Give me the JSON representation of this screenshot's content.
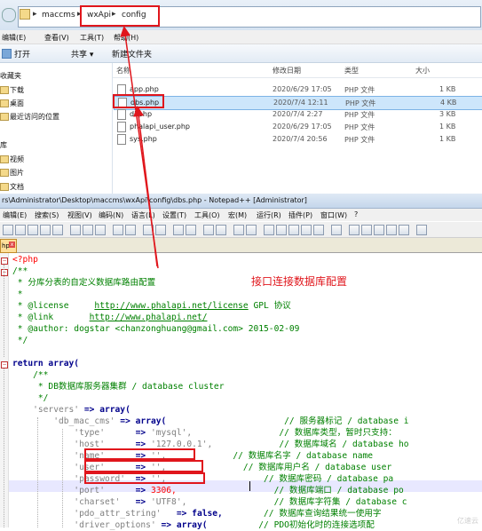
{
  "explorer": {
    "breadcrumb": [
      "maccms",
      "wxApi",
      "config"
    ],
    "menu": [
      "编辑(E)",
      "查看(V)",
      "工具(T)",
      "帮助(H)"
    ],
    "toolbar": {
      "open": "打开",
      "share": "共享 ▾",
      "new_folder": "新建文件夹"
    },
    "nav_items": [
      {
        "label": "收藏夹",
        "icon": "star-icon"
      },
      {
        "label": "下载",
        "icon": "folder-icon"
      },
      {
        "label": "桌面",
        "icon": "folder-icon"
      },
      {
        "label": "最近访问的位置",
        "icon": "folder-icon"
      },
      {
        "label": "库",
        "icon": "library-icon"
      },
      {
        "label": "视频",
        "icon": "folder-icon"
      },
      {
        "label": "图片",
        "icon": "folder-icon"
      },
      {
        "label": "文档",
        "icon": "folder-icon"
      }
    ],
    "columns": {
      "name": "名称",
      "modified": "修改日期",
      "type": "类型",
      "size": "大小"
    },
    "files": [
      {
        "name": "app.php",
        "modified": "2020/6/29 17:05",
        "type": "PHP 文件",
        "size": "1 KB"
      },
      {
        "name": "dbs.php",
        "modified": "2020/7/4 12:11",
        "type": "PHP 文件",
        "size": "4 KB"
      },
      {
        "name": "di.php",
        "modified": "2020/7/4 2:27",
        "type": "PHP 文件",
        "size": "3 KB"
      },
      {
        "name": "phalapi_user.php",
        "modified": "2020/6/29 17:05",
        "type": "PHP 文件",
        "size": "1 KB"
      },
      {
        "name": "sys.php",
        "modified": "2020/7/4 20:56",
        "type": "PHP 文件",
        "size": "1 KB"
      }
    ]
  },
  "npp": {
    "title": "rs\\Administrator\\Desktop\\maccms\\wxApi\\config\\dbs.php - Notepad++ [Administrator]",
    "menu": [
      "编辑(E)",
      "搜索(S)",
      "视图(V)",
      "编码(N)",
      "语言(L)",
      "设置(T)",
      "工具(O)",
      "宏(M)",
      "运行(R)",
      "插件(P)",
      "窗口(W)",
      "?"
    ],
    "tab_label": "hp",
    "tab_close": "x",
    "code": {
      "l1": "<?php",
      "l2": "/**",
      "l3": " * 分库分表的自定义数据库路由配置",
      "l4": " *",
      "l5a": " * @license     ",
      "l5b": "http://www.phalapi.net/license",
      "l5c": " GPL 协议",
      "l6a": " * @link       ",
      "l6b": "http://www.phalapi.net/",
      "l7": " * @author: dogstar <chanzonghuang@gmail.com> 2015-02-09",
      "l8": " */",
      "l9": "",
      "l10a": "return",
      "l10b": " array(",
      "l11": "    /**",
      "l12": "     * DB数据库服务器集群 / database cluster",
      "l13": "     */",
      "l14a": "    'servers'",
      "l14b": " => ",
      "l14c": "array(",
      "l15a": "        'db_mac_cms'",
      "l15b": " => ",
      "l15c": "array(",
      "l15d": "                       // 服务器标记 / database i",
      "l16a": "            'type'",
      "l16b": "      => ",
      "l16c": "'mysql',",
      "l16d": "                 // 数据库类型，暂时只支持：",
      "l17a": "            'host'",
      "l17b": "      => ",
      "l17c": "'127.0.0.1',",
      "l17d": "             // 数据库域名 / database ho",
      "l18a": "            'name'",
      "l18b": "      => ",
      "l18c": "'',",
      "l18d": "             // 数据库名字 / database name",
      "l19a": "            'user'",
      "l19b": "      => ",
      "l19c": "'',",
      "l19d": "               // 数据库用户名 / database user",
      "l20a": "            'password'",
      "l20b": "  => ",
      "l20c": "'',",
      "l20d": "                   // 数据库密码 / database pa",
      "l21a": "            'port'",
      "l21b": "      => ",
      "l21c": "3306,",
      "l21d": "                   // 数据库端口 / database po",
      "l22a": "            'charset'",
      "l22b": "   => ",
      "l22c": "'UTF8',",
      "l22d": "                 // 数据库字符集 / database c",
      "l23a": "            'pdo_attr_string'",
      "l23b": "   => ",
      "l23c": "false,",
      "l23d": "        // 数据库查询结果统一使用字",
      "l24a": "            'driver_options'",
      "l24b": " => ",
      "l24c": "array(",
      "l24d": "          // PDO初始化时的连接选项配"
    }
  },
  "annotation": {
    "text": "接口连接数据库配置",
    "color": "#e0161c"
  },
  "watermark": "亿速云"
}
